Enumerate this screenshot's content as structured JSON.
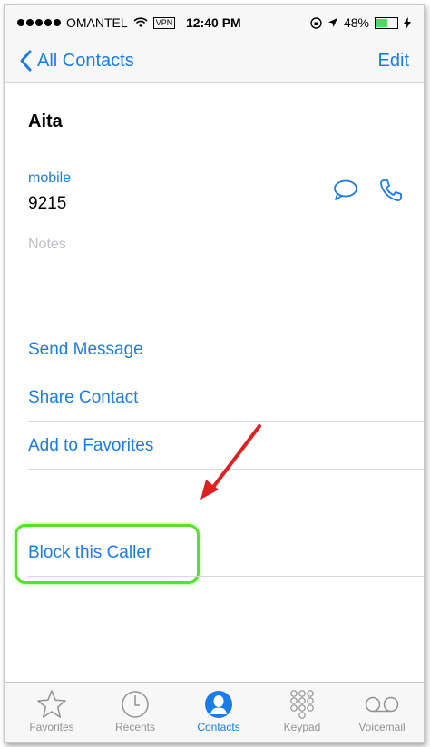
{
  "status_bar": {
    "carrier": "OMANTEL",
    "vpn": "VPN",
    "time": "12:40 PM",
    "battery": "48%",
    "battery_level": 0.48
  },
  "nav": {
    "back_label": "All Contacts",
    "edit_label": "Edit"
  },
  "contact": {
    "name": "Aita",
    "phone_label": "mobile",
    "phone_number": "9215",
    "notes_placeholder": "Notes"
  },
  "actions": {
    "send_message": "Send Message",
    "share_contact": "Share Contact",
    "add_to_favorites": "Add to Favorites",
    "block_caller": "Block this Caller"
  },
  "tabs": [
    {
      "label": "Favorites",
      "icon": "star-icon"
    },
    {
      "label": "Recents",
      "icon": "clock-icon"
    },
    {
      "label": "Contacts",
      "icon": "person-icon"
    },
    {
      "label": "Keypad",
      "icon": "keypad-icon"
    },
    {
      "label": "Voicemail",
      "icon": "voicemail-icon"
    }
  ],
  "colors": {
    "accent": "#1a7ce6",
    "highlight": "#57e030",
    "annotation_arrow": "#e02020"
  }
}
